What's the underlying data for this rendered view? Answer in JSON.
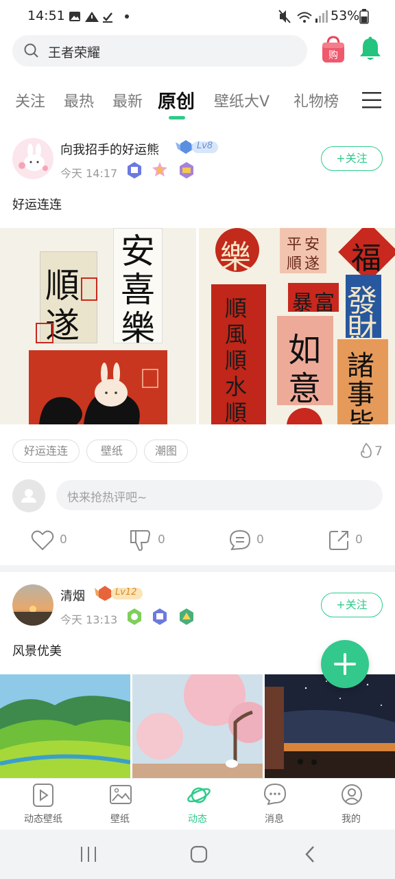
{
  "status_bar": {
    "time": "14:51",
    "battery": "53%"
  },
  "search": {
    "query": "王者荣耀"
  },
  "tabs": [
    "关注",
    "最热",
    "最新",
    "原创",
    "壁纸大V",
    "礼物榜"
  ],
  "posts": [
    {
      "user": "向我招手的好运熊",
      "level": "Lv8",
      "time": "今天 14:17",
      "follow_label": "+关注",
      "text": "好运连连",
      "tags": [
        "好运连连",
        "壁纸",
        "潮图"
      ],
      "heat": "7",
      "comment_placeholder": "快来抢热评吧~",
      "likes": "0",
      "dislikes": "0",
      "comments": "0",
      "shares": "0",
      "calligraphy": [
        "安",
        "喜",
        "樂",
        "順",
        "遂",
        "樂",
        "平",
        "安",
        "順",
        "遂",
        "福",
        "順",
        "風",
        "順",
        "水",
        "順",
        "財",
        "暴",
        "富",
        "發",
        "財",
        "如",
        "意",
        "諸",
        "事",
        "皆"
      ]
    },
    {
      "user": "清烟",
      "level": "Lv12",
      "time": "今天 13:13",
      "follow_label": "+关注",
      "text": "风景优美"
    }
  ],
  "bottom_nav": [
    "动态壁纸",
    "壁纸",
    "动态",
    "消息",
    "我的"
  ],
  "colors": {
    "accent": "#2ecb8a",
    "accent_fab": "#33c98c",
    "red": "#c8281e"
  }
}
